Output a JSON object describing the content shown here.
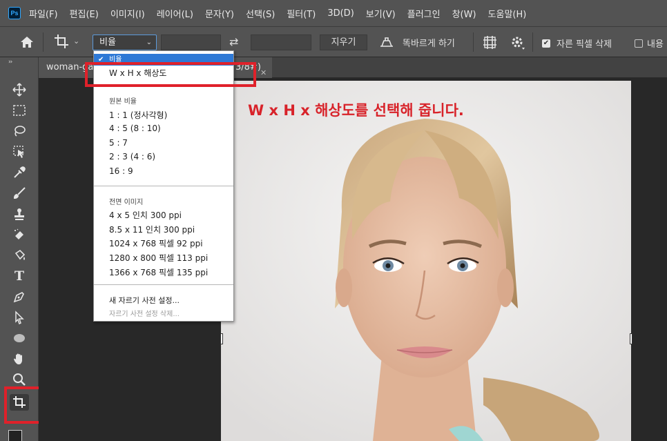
{
  "app": {
    "logo": "Ps"
  },
  "menu": [
    "파일(F)",
    "편집(E)",
    "이미지(I)",
    "레이어(L)",
    "문자(Y)",
    "선택(S)",
    "필터(T)",
    "3D(D)",
    "보기(V)",
    "플러그인",
    "창(W)",
    "도움말(H)"
  ],
  "options_bar": {
    "ratio_select_value": "비율",
    "clear_label": "지우기",
    "straighten_label": "똑바르게 하기",
    "delete_cropped_label": "자른 픽셀 삭제",
    "delete_cropped_checked": true,
    "content_aware_label": "내용",
    "content_aware_checked": false
  },
  "document": {
    "tab_title": "woman-ga",
    "tab_title_suffix": "3/8#)"
  },
  "annotation": "W x H x 해상도를 선택해 줍니다.",
  "dropdown": {
    "selected": "비율",
    "wxh_item": "W x H x 해상도",
    "original_ratio_header": "원본 비율",
    "ratios": [
      "1 : 1 (정사각형)",
      "4 : 5 (8 : 10)",
      "5 : 7",
      "2 : 3 (4 : 6)",
      "16 : 9"
    ],
    "full_image_header": "전면 이미지",
    "presets": [
      "4 x 5 인치 300 ppi",
      "8.5 x 11 인치 300 ppi",
      "1024 x 768 픽셀 92 ppi",
      "1280 x 800 픽셀 113 ppi",
      "1366 x 768 픽셀 135 ppi"
    ],
    "new_preset": "새 자르기 사전 설정...",
    "delete_preset": "자르기 사전 설정 삭제..."
  },
  "colors": {
    "highlight": "#e0212a",
    "annotation": "#d8232a",
    "dropdown_selected": "#2e79d6"
  }
}
